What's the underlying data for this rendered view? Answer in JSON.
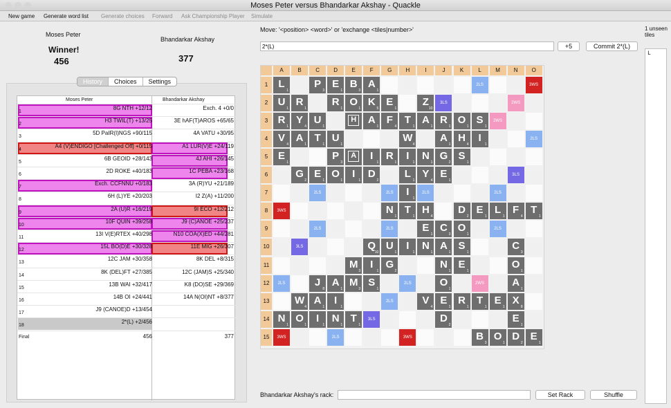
{
  "window": {
    "title": "Moses Peter versus Bhandarkar Akshay - Quackle"
  },
  "toolbar": [
    {
      "label": "New game",
      "enabled": true
    },
    {
      "label": "Generate word list",
      "enabled": true
    },
    {
      "label": "Generate choices",
      "enabled": false
    },
    {
      "label": "Forward",
      "enabled": false
    },
    {
      "label": "Ask Championship Player",
      "enabled": false
    },
    {
      "label": "Simulate",
      "enabled": false
    }
  ],
  "players": {
    "p1": {
      "name": "Moses Peter",
      "status": "Winner!",
      "score": "456"
    },
    "p2": {
      "name": "Bhandarkar Akshay",
      "score": "377"
    }
  },
  "tabs": [
    {
      "label": "History",
      "selected": true
    },
    {
      "label": "Choices",
      "selected": false
    },
    {
      "label": "Settings",
      "selected": false
    }
  ],
  "history": {
    "headers": [
      "Moses Peter",
      "Bhandarkar Akshay"
    ],
    "rows": [
      {
        "n": "1",
        "p1": "8G NTH  +12/12",
        "p2": "Exch. 4  +0/0"
      },
      {
        "n": "2",
        "p1": "H3 TWIL(T)  +13/25",
        "p2": "3E hAF(T)AROS  +65/65"
      },
      {
        "n": "3",
        "p1": "5D PaIR(I)NGS  +90/115",
        "p2": "4A VATU  +30/95"
      },
      {
        "n": "4",
        "p1": "A4 (V)ENDIGO [Challenged Off]  +0/115",
        "p2": "A1 LUR(V)E  +24/119"
      },
      {
        "n": "5",
        "p1": "6B GEOID  +28/143",
        "p2": "4J AHI  +26/145"
      },
      {
        "n": "6",
        "p1": "2D ROKE  +40/183",
        "p2": "1C PEBA  +23/168"
      },
      {
        "n": "7",
        "p1": "Exch. CCFNNU  +0/183",
        "p2": "3A (R)YU  +21/189"
      },
      {
        "n": "8",
        "p1": "6H (L)YE  +20/203",
        "p2": "I2 Z(A)  +11/200"
      },
      {
        "n": "9",
        "p1": "2A (U)R  +16/219",
        "p2": "9I ECO  +12/212"
      },
      {
        "n": "10",
        "p1": "10F QUIN  +39/258",
        "p2": "J9 (C)ANOE  +25/237"
      },
      {
        "n": "11",
        "p1": "13I V(E)RTEX  +40/298",
        "p2": "N10 COA(X)ED  +44/281"
      },
      {
        "n": "12",
        "p1": "15L BO(D)E  +30/328",
        "p2": "11E MIG  +26/307"
      },
      {
        "n": "13",
        "p1": "12C JAM  +30/358",
        "p2": "8K DEL  +8/315"
      },
      {
        "n": "14",
        "p1": "8K (DEL)FT  +27/385",
        "p2": "12C (JAM)S  +25/340"
      },
      {
        "n": "15",
        "p1": "13B WAI  +32/417",
        "p2": "K8 (DO)SE  +29/369"
      },
      {
        "n": "16",
        "p1": "14B OI  +24/441",
        "p2": "14A N(OI)NT  +8/377"
      },
      {
        "n": "17",
        "p1": "J9 (CANOE)D  +13/454",
        "p2": ""
      },
      {
        "n": "18",
        "p1": "2*(L)  +2/456",
        "p2": ""
      },
      {
        "n": "Final",
        "p1": "456",
        "p2": "377"
      }
    ]
  },
  "move": {
    "label": "Move: '<position> <word>' or 'exchange <tiles|number>'",
    "value": "2*(L)",
    "score_button": "+5",
    "commit_button": "Commit 2*(L)"
  },
  "unseen": {
    "label": "1 unseen tiles",
    "tiles": "L"
  },
  "rack": {
    "label": "Bhandarkar Akshay's rack:",
    "value": "",
    "set_button": "Set Rack",
    "shuffle_button": "Shuffle"
  },
  "board": {
    "columns": [
      "A",
      "B",
      "C",
      "D",
      "E",
      "F",
      "G",
      "H",
      "I",
      "J",
      "K",
      "L",
      "M",
      "N",
      "O"
    ],
    "rows": [
      "1",
      "2",
      "3",
      "4",
      "5",
      "6",
      "7",
      "8",
      "9",
      "10",
      "11",
      "12",
      "13",
      "14",
      "15"
    ],
    "premium_labels": {
      "tw": "3WS",
      "dw": "2WS",
      "tl": "3LS",
      "dl": "2LS"
    },
    "premiums": [
      {
        "r": 1,
        "c": 15,
        "t": "tw"
      },
      {
        "r": 1,
        "c": 12,
        "t": "dl"
      },
      {
        "r": 2,
        "c": 10,
        "t": "tl"
      },
      {
        "r": 2,
        "c": 14,
        "t": "dw"
      },
      {
        "r": 3,
        "c": 13,
        "t": "dw"
      },
      {
        "r": 4,
        "c": 15,
        "t": "dl"
      },
      {
        "r": 6,
        "c": 14,
        "t": "tl"
      },
      {
        "r": 7,
        "c": 3,
        "t": "dl"
      },
      {
        "r": 7,
        "c": 7,
        "t": "dl"
      },
      {
        "r": 7,
        "c": 9,
        "t": "dl"
      },
      {
        "r": 7,
        "c": 13,
        "t": "dl"
      },
      {
        "r": 8,
        "c": 1,
        "t": "tw"
      },
      {
        "r": 9,
        "c": 3,
        "t": "dl"
      },
      {
        "r": 9,
        "c": 7,
        "t": "dl"
      },
      {
        "r": 9,
        "c": 13,
        "t": "dl"
      },
      {
        "r": 10,
        "c": 2,
        "t": "tl"
      },
      {
        "r": 12,
        "c": 1,
        "t": "dl"
      },
      {
        "r": 12,
        "c": 8,
        "t": "dl"
      },
      {
        "r": 12,
        "c": 12,
        "t": "dw"
      },
      {
        "r": 13,
        "c": 7,
        "t": "dl"
      },
      {
        "r": 14,
        "c": 6,
        "t": "tl"
      },
      {
        "r": 15,
        "c": 1,
        "t": "tw"
      },
      {
        "r": 15,
        "c": 4,
        "t": "dl"
      },
      {
        "r": 15,
        "c": 8,
        "t": "tw"
      }
    ],
    "tiles": [
      {
        "r": 1,
        "c": 1,
        "l": "L",
        "s": "1"
      },
      {
        "r": 1,
        "c": 3,
        "l": "P",
        "s": "3"
      },
      {
        "r": 1,
        "c": 4,
        "l": "E",
        "s": "1"
      },
      {
        "r": 1,
        "c": 5,
        "l": "B",
        "s": "3"
      },
      {
        "r": 1,
        "c": 6,
        "l": "A",
        "s": "1"
      },
      {
        "r": 2,
        "c": 1,
        "l": "U",
        "s": "1"
      },
      {
        "r": 2,
        "c": 2,
        "l": "R",
        "s": "1"
      },
      {
        "r": 2,
        "c": 4,
        "l": "R",
        "s": "1"
      },
      {
        "r": 2,
        "c": 5,
        "l": "O",
        "s": "1"
      },
      {
        "r": 2,
        "c": 6,
        "l": "K",
        "s": "5"
      },
      {
        "r": 2,
        "c": 7,
        "l": "E",
        "s": "1"
      },
      {
        "r": 2,
        "c": 9,
        "l": "Z",
        "s": "10"
      },
      {
        "r": 3,
        "c": 1,
        "l": "R",
        "s": "1"
      },
      {
        "r": 3,
        "c": 2,
        "l": "Y",
        "s": "4"
      },
      {
        "r": 3,
        "c": 3,
        "l": "U",
        "s": "1"
      },
      {
        "r": 3,
        "c": 5,
        "l": "H",
        "s": "",
        "b": true
      },
      {
        "r": 3,
        "c": 6,
        "l": "A",
        "s": "1"
      },
      {
        "r": 3,
        "c": 7,
        "l": "F",
        "s": "4"
      },
      {
        "r": 3,
        "c": 8,
        "l": "T",
        "s": "1"
      },
      {
        "r": 3,
        "c": 9,
        "l": "A",
        "s": "1"
      },
      {
        "r": 3,
        "c": 10,
        "l": "R",
        "s": "1"
      },
      {
        "r": 3,
        "c": 11,
        "l": "O",
        "s": "1"
      },
      {
        "r": 3,
        "c": 12,
        "l": "S",
        "s": "1"
      },
      {
        "r": 4,
        "c": 1,
        "l": "V",
        "s": "4"
      },
      {
        "r": 4,
        "c": 2,
        "l": "A",
        "s": "1"
      },
      {
        "r": 4,
        "c": 3,
        "l": "T",
        "s": "1"
      },
      {
        "r": 4,
        "c": 4,
        "l": "U",
        "s": "1"
      },
      {
        "r": 4,
        "c": 8,
        "l": "W",
        "s": "4"
      },
      {
        "r": 4,
        "c": 10,
        "l": "A",
        "s": "1"
      },
      {
        "r": 4,
        "c": 11,
        "l": "H",
        "s": "4"
      },
      {
        "r": 4,
        "c": 12,
        "l": "I",
        "s": "1"
      },
      {
        "r": 5,
        "c": 1,
        "l": "E",
        "s": "1"
      },
      {
        "r": 5,
        "c": 4,
        "l": "P",
        "s": "3"
      },
      {
        "r": 5,
        "c": 5,
        "l": "A",
        "s": "",
        "b": true
      },
      {
        "r": 5,
        "c": 6,
        "l": "I",
        "s": "1"
      },
      {
        "r": 5,
        "c": 7,
        "l": "R",
        "s": "1"
      },
      {
        "r": 5,
        "c": 8,
        "l": "I",
        "s": "1"
      },
      {
        "r": 5,
        "c": 9,
        "l": "N",
        "s": "1"
      },
      {
        "r": 5,
        "c": 10,
        "l": "G",
        "s": "2"
      },
      {
        "r": 5,
        "c": 11,
        "l": "S",
        "s": "1"
      },
      {
        "r": 6,
        "c": 2,
        "l": "G",
        "s": "2"
      },
      {
        "r": 6,
        "c": 3,
        "l": "E",
        "s": "1"
      },
      {
        "r": 6,
        "c": 4,
        "l": "O",
        "s": "1"
      },
      {
        "r": 6,
        "c": 5,
        "l": "I",
        "s": "1"
      },
      {
        "r": 6,
        "c": 6,
        "l": "D",
        "s": "2"
      },
      {
        "r": 6,
        "c": 8,
        "l": "L",
        "s": "1"
      },
      {
        "r": 6,
        "c": 9,
        "l": "Y",
        "s": "4"
      },
      {
        "r": 6,
        "c": 10,
        "l": "E",
        "s": "1"
      },
      {
        "r": 7,
        "c": 8,
        "l": "I",
        "s": "1"
      },
      {
        "r": 8,
        "c": 7,
        "l": "N",
        "s": "1"
      },
      {
        "r": 8,
        "c": 8,
        "l": "T",
        "s": "1"
      },
      {
        "r": 8,
        "c": 9,
        "l": "H",
        "s": "4"
      },
      {
        "r": 8,
        "c": 11,
        "l": "D",
        "s": "2"
      },
      {
        "r": 8,
        "c": 12,
        "l": "E",
        "s": "1"
      },
      {
        "r": 8,
        "c": 13,
        "l": "L",
        "s": "1"
      },
      {
        "r": 8,
        "c": 14,
        "l": "F",
        "s": "4"
      },
      {
        "r": 8,
        "c": 15,
        "l": "T",
        "s": "1"
      },
      {
        "r": 9,
        "c": 9,
        "l": "E",
        "s": "1"
      },
      {
        "r": 9,
        "c": 10,
        "l": "C",
        "s": "3"
      },
      {
        "r": 9,
        "c": 11,
        "l": "O",
        "s": "1"
      },
      {
        "r": 10,
        "c": 6,
        "l": "Q",
        "s": "10"
      },
      {
        "r": 10,
        "c": 7,
        "l": "U",
        "s": "1"
      },
      {
        "r": 10,
        "c": 8,
        "l": "I",
        "s": "1"
      },
      {
        "r": 10,
        "c": 9,
        "l": "N",
        "s": "1"
      },
      {
        "r": 10,
        "c": 10,
        "l": "A",
        "s": "1"
      },
      {
        "r": 10,
        "c": 11,
        "l": "S",
        "s": "1"
      },
      {
        "r": 10,
        "c": 14,
        "l": "C",
        "s": "3"
      },
      {
        "r": 11,
        "c": 5,
        "l": "M",
        "s": "3"
      },
      {
        "r": 11,
        "c": 6,
        "l": "I",
        "s": "1"
      },
      {
        "r": 11,
        "c": 7,
        "l": "G",
        "s": "2"
      },
      {
        "r": 11,
        "c": 10,
        "l": "N",
        "s": "1"
      },
      {
        "r": 11,
        "c": 11,
        "l": "E",
        "s": "1"
      },
      {
        "r": 11,
        "c": 14,
        "l": "O",
        "s": "1"
      },
      {
        "r": 12,
        "c": 3,
        "l": "J",
        "s": "8"
      },
      {
        "r": 12,
        "c": 4,
        "l": "A",
        "s": "1"
      },
      {
        "r": 12,
        "c": 5,
        "l": "M",
        "s": "3"
      },
      {
        "r": 12,
        "c": 6,
        "l": "S",
        "s": "1"
      },
      {
        "r": 12,
        "c": 10,
        "l": "O",
        "s": "1"
      },
      {
        "r": 12,
        "c": 14,
        "l": "A",
        "s": "1"
      },
      {
        "r": 13,
        "c": 2,
        "l": "W",
        "s": "4"
      },
      {
        "r": 13,
        "c": 3,
        "l": "A",
        "s": "1"
      },
      {
        "r": 13,
        "c": 4,
        "l": "I",
        "s": "1"
      },
      {
        "r": 13,
        "c": 9,
        "l": "V",
        "s": "4"
      },
      {
        "r": 13,
        "c": 10,
        "l": "E",
        "s": "1"
      },
      {
        "r": 13,
        "c": 11,
        "l": "R",
        "s": "1"
      },
      {
        "r": 13,
        "c": 12,
        "l": "T",
        "s": "1"
      },
      {
        "r": 13,
        "c": 13,
        "l": "E",
        "s": "1"
      },
      {
        "r": 13,
        "c": 14,
        "l": "X",
        "s": "8"
      },
      {
        "r": 14,
        "c": 1,
        "l": "N",
        "s": "1"
      },
      {
        "r": 14,
        "c": 2,
        "l": "O",
        "s": "1"
      },
      {
        "r": 14,
        "c": 3,
        "l": "I",
        "s": "1"
      },
      {
        "r": 14,
        "c": 4,
        "l": "N",
        "s": "1"
      },
      {
        "r": 14,
        "c": 5,
        "l": "T",
        "s": "1"
      },
      {
        "r": 14,
        "c": 10,
        "l": "D",
        "s": "2"
      },
      {
        "r": 14,
        "c": 14,
        "l": "E",
        "s": "1"
      },
      {
        "r": 15,
        "c": 12,
        "l": "B",
        "s": "3"
      },
      {
        "r": 15,
        "c": 13,
        "l": "O",
        "s": "1"
      },
      {
        "r": 15,
        "c": 14,
        "l": "D",
        "s": "2"
      },
      {
        "r": 15,
        "c": 15,
        "l": "E",
        "s": "1"
      }
    ]
  },
  "colors": {
    "tile": "#6e6e6e",
    "triple_word": "#d32222",
    "double_word": "#f49ac0",
    "triple_letter": "#7568e4",
    "double_letter": "#8ab2f0",
    "header": "#f2c999",
    "hl_magenta": "#c013c0",
    "hl_red": "#d01515"
  }
}
